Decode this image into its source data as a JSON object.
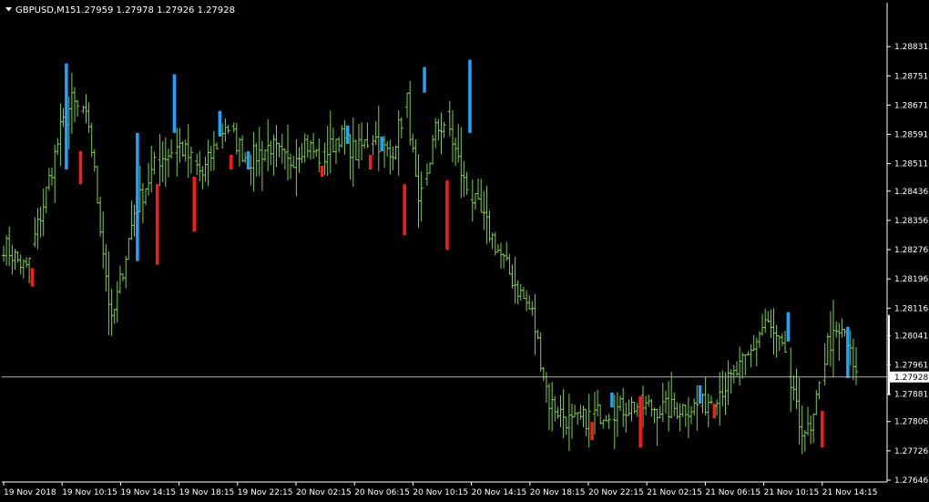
{
  "header": {
    "symbol": "GBPUSD,M15",
    "ohlc": "1.27959 1.27978 1.27926 1.27928"
  },
  "colors": {
    "background": "#000000",
    "bar_up": "#7bd144",
    "bar_down_long": "#ff1a1a",
    "bar_up_long": "#1ea5ff",
    "axis": "#ffffff",
    "price_line": "#b0b0b0"
  },
  "chart_data": {
    "type": "bar",
    "style": "ohlc-bars",
    "ylim": [
      1.27646,
      1.28911
    ],
    "y_ticks": [
      "1.28831",
      "1.28751",
      "1.28671",
      "1.28591",
      "1.28511",
      "1.28436",
      "1.28356",
      "1.28276",
      "1.28196",
      "1.28116",
      "1.28041",
      "1.27961",
      "1.27881",
      "1.27806",
      "1.27726",
      "1.27646"
    ],
    "x_ticks": [
      "19 Nov 2018",
      "19 Nov 10:15",
      "19 Nov 14:15",
      "19 Nov 18:15",
      "19 Nov 22:15",
      "20 Nov 02:15",
      "20 Nov 06:15",
      "20 Nov 10:15",
      "20 Nov 14:15",
      "20 Nov 18:15",
      "20 Nov 22:15",
      "21 Nov 02:15",
      "21 Nov 06:15",
      "21 Nov 10:15",
      "21 Nov 14:15"
    ],
    "current_price": "1.27928",
    "key_points": [
      {
        "i": 0,
        "v": 1.2829
      },
      {
        "i": 8,
        "v": 1.2822
      },
      {
        "i": 14,
        "v": 1.284
      },
      {
        "i": 20,
        "v": 1.286
      },
      {
        "i": 24,
        "v": 1.2868
      },
      {
        "i": 30,
        "v": 1.2862
      },
      {
        "i": 38,
        "v": 1.2807
      },
      {
        "i": 46,
        "v": 1.2838
      },
      {
        "i": 54,
        "v": 1.2852
      },
      {
        "i": 62,
        "v": 1.2856
      },
      {
        "i": 70,
        "v": 1.2848
      },
      {
        "i": 78,
        "v": 1.2862
      },
      {
        "i": 86,
        "v": 1.2852
      },
      {
        "i": 94,
        "v": 1.2856
      },
      {
        "i": 100,
        "v": 1.2851
      },
      {
        "i": 106,
        "v": 1.2857
      },
      {
        "i": 112,
        "v": 1.2852
      },
      {
        "i": 118,
        "v": 1.2859
      },
      {
        "i": 124,
        "v": 1.2854
      },
      {
        "i": 130,
        "v": 1.2859
      },
      {
        "i": 136,
        "v": 1.2853
      },
      {
        "i": 142,
        "v": 1.2868
      },
      {
        "i": 146,
        "v": 1.2838
      },
      {
        "i": 152,
        "v": 1.286
      },
      {
        "i": 156,
        "v": 1.2863
      },
      {
        "i": 162,
        "v": 1.2846
      },
      {
        "i": 170,
        "v": 1.2834
      },
      {
        "i": 178,
        "v": 1.2821
      },
      {
        "i": 186,
        "v": 1.281
      },
      {
        "i": 192,
        "v": 1.2786
      },
      {
        "i": 200,
        "v": 1.278
      },
      {
        "i": 210,
        "v": 1.2783
      },
      {
        "i": 222,
        "v": 1.2785
      },
      {
        "i": 234,
        "v": 1.2784
      },
      {
        "i": 246,
        "v": 1.2785
      },
      {
        "i": 256,
        "v": 1.2792
      },
      {
        "i": 262,
        "v": 1.2798
      },
      {
        "i": 268,
        "v": 1.2808
      },
      {
        "i": 274,
        "v": 1.28
      },
      {
        "i": 280,
        "v": 1.278
      },
      {
        "i": 284,
        "v": 1.2777
      },
      {
        "i": 290,
        "v": 1.2802
      },
      {
        "i": 296,
        "v": 1.2805
      },
      {
        "i": 300,
        "v": 1.2792
      }
    ],
    "highlight_bars": [
      {
        "i": 10,
        "o": 1.2818,
        "c": 1.2822,
        "color": "red"
      },
      {
        "i": 22,
        "o": 1.2878,
        "c": 1.285,
        "color": "blue"
      },
      {
        "i": 27,
        "o": 1.2854,
        "c": 1.2846,
        "color": "red"
      },
      {
        "i": 47,
        "o": 1.2825,
        "c": 1.2859,
        "color": "blue"
      },
      {
        "i": 54,
        "o": 1.2845,
        "c": 1.2824,
        "color": "red"
      },
      {
        "i": 60,
        "o": 1.2875,
        "c": 1.286,
        "color": "blue"
      },
      {
        "i": 67,
        "o": 1.2847,
        "c": 1.2833,
        "color": "red"
      },
      {
        "i": 76,
        "o": 1.2865,
        "c": 1.2859,
        "color": "blue"
      },
      {
        "i": 80,
        "o": 1.2853,
        "c": 1.285,
        "color": "red"
      },
      {
        "i": 86,
        "o": 1.285,
        "c": 1.2854,
        "color": "blue"
      },
      {
        "i": 112,
        "o": 1.285,
        "c": 1.2848,
        "color": "red"
      },
      {
        "i": 121,
        "o": 1.2857,
        "c": 1.2861,
        "color": "blue"
      },
      {
        "i": 129,
        "o": 1.2853,
        "c": 1.285,
        "color": "red"
      },
      {
        "i": 133,
        "o": 1.2858,
        "c": 1.2855,
        "color": "blue"
      },
      {
        "i": 141,
        "o": 1.2845,
        "c": 1.2832,
        "color": "red"
      },
      {
        "i": 148,
        "o": 1.2877,
        "c": 1.2871,
        "color": "blue"
      },
      {
        "i": 156,
        "o": 1.2846,
        "c": 1.2828,
        "color": "red"
      },
      {
        "i": 164,
        "o": 1.2879,
        "c": 1.286,
        "color": "blue"
      },
      {
        "i": 207,
        "o": 1.278,
        "c": 1.2776,
        "color": "red"
      },
      {
        "i": 214,
        "o": 1.2788,
        "c": 1.2785,
        "color": "blue"
      },
      {
        "i": 224,
        "o": 1.2787,
        "c": 1.2774,
        "color": "red"
      },
      {
        "i": 245,
        "o": 1.2786,
        "c": 1.279,
        "color": "blue"
      },
      {
        "i": 250,
        "o": 1.2785,
        "c": 1.2782,
        "color": "red"
      },
      {
        "i": 276,
        "o": 1.281,
        "c": 1.2803,
        "color": "blue"
      },
      {
        "i": 288,
        "o": 1.2783,
        "c": 1.2774,
        "color": "red"
      },
      {
        "i": 297,
        "o": 1.2806,
        "c": 1.2793,
        "color": "blue"
      }
    ]
  }
}
